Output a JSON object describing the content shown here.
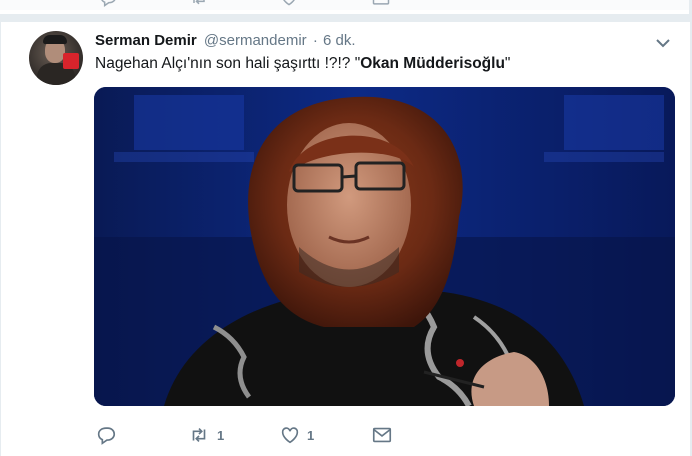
{
  "tweet": {
    "author_name": "Serman Demir",
    "author_handle": "@sermandemir",
    "separator": "·",
    "timestamp": "6 dk.",
    "text_prefix": "Nagehan Alçı'nın son hali şaşırttı !?!? \"",
    "text_bold": "Okan Müdderisoğlu",
    "text_suffix": "\"",
    "media_alt": "",
    "stats": {
      "reply_count": "",
      "retweet_count": "1",
      "like_count": "1"
    }
  },
  "icons": {
    "menu": "chevron-down-icon",
    "reply": "reply-icon",
    "retweet": "retweet-icon",
    "like": "heart-icon",
    "message": "envelope-icon"
  },
  "colors": {
    "secondary_text": "#657786",
    "separator": "#e6ecf0",
    "media_backdrop": "#0a1d5c"
  }
}
